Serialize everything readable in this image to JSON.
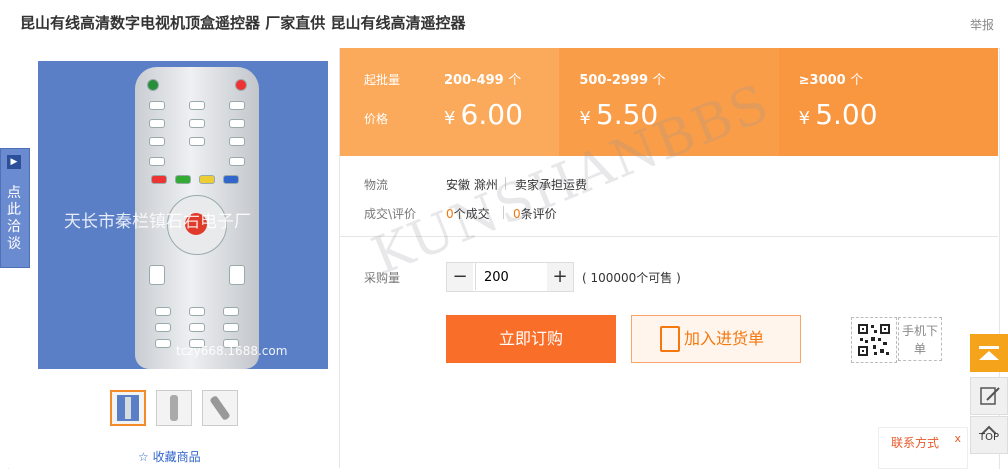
{
  "header": {
    "title": "昆山有线高清数字电视机顶盒遥控器 厂家直供 昆山有线高清遥控器",
    "report_label": "举报"
  },
  "side_tab": {
    "label": "点此洽谈"
  },
  "gallery": {
    "watermark_text": "天长市秦栏镇石右电子厂",
    "watermark_url": "tczy668.1688.com",
    "favorite_label": "收藏商品"
  },
  "price_panel": {
    "qty_label": "起批量",
    "price_label": "价格",
    "unit": "个",
    "currency": "¥",
    "tiers": [
      {
        "range": "200-499",
        "price": "6.00"
      },
      {
        "range": "500-2999",
        "price": "5.50"
      },
      {
        "range": "≥3000",
        "price": "5.00"
      }
    ]
  },
  "logistics": {
    "label": "物流",
    "origin": "安徽 滁州",
    "shipping": "卖家承担运费"
  },
  "deals": {
    "label": "成交\\评价",
    "sold_count": "0",
    "sold_suffix": "个成交",
    "review_count": "0",
    "review_suffix": "条评价"
  },
  "purchase": {
    "label": "采购量",
    "quantity": "200",
    "minus": "−",
    "plus": "+",
    "stock": "( 100000个可售 )"
  },
  "actions": {
    "buy_label": "立即订购",
    "cart_label": "加入进货单",
    "mobile_label": "手机下单"
  },
  "watermark": {
    "text": "KUNSHANBBS"
  },
  "toolbar": {
    "top_label": "TOP",
    "contact_label": "联系方式",
    "contact_close": "x"
  },
  "colors": {
    "accent": "#f96e28",
    "tier_bg": "#fba95a",
    "link": "#3366cc"
  }
}
